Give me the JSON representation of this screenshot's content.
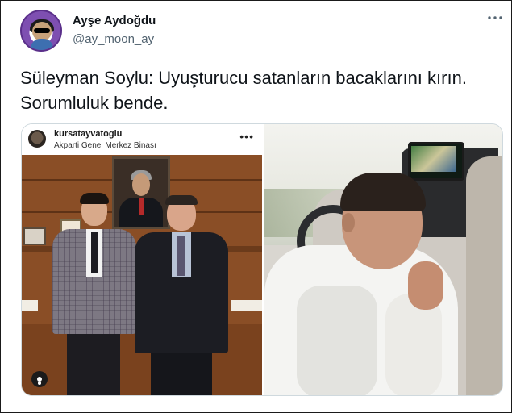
{
  "tweet": {
    "display_name": "Ayşe Aydoğdu",
    "handle": "@ay_moon_ay",
    "more_icon": "more-horizontal-icon",
    "text": "Süleyman Soylu: Uyuşturucu satanların bacaklarını kırın. Sorumluluk bende."
  },
  "media": {
    "left": {
      "username": "kursatayvatoglu",
      "location": "Akparti Genel Merkez Binası",
      "menu_icon": "more-dots-icon",
      "tag_icon": "user-tag-icon"
    },
    "right": {
      "description_icon": "video-still"
    }
  },
  "colors": {
    "text_primary": "#0f1419",
    "text_secondary": "#536471",
    "border": "#cfd9de"
  }
}
